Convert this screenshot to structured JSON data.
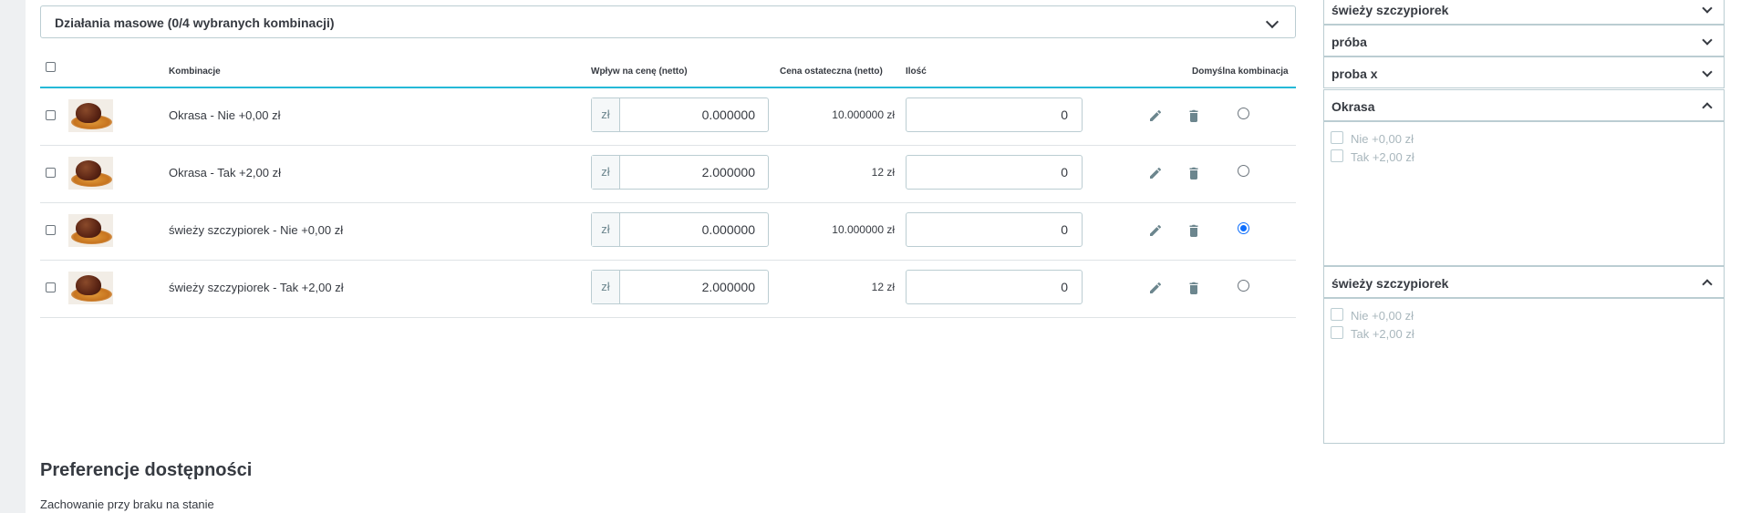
{
  "bulk_actions": {
    "label": "Działania masowe (0/4 wybranych kombinacji)"
  },
  "table": {
    "headers": {
      "combinations": "Kombinacje",
      "price_impact": "Wpływ na cenę (netto)",
      "final_price": "Cena ostateczna (netto)",
      "quantity": "Ilość",
      "default": "Domyślna kombinacja"
    },
    "rows": [
      {
        "name": "Okrasa - Nie +0,00 zł",
        "currency": "zł",
        "impact": "0.000000",
        "final": "10.000000 zł",
        "qty": "0",
        "default": false
      },
      {
        "name": "Okrasa - Tak +2,00 zł",
        "currency": "zł",
        "impact": "2.000000",
        "final": "12 zł",
        "qty": "0",
        "default": false
      },
      {
        "name": "świeży szczypiorek - Nie +0,00 zł",
        "currency": "zł",
        "impact": "0.000000",
        "final": "10.000000 zł",
        "qty": "0",
        "default": true
      },
      {
        "name": "świeży szczypiorek - Tak +2,00 zł",
        "currency": "zł",
        "impact": "2.000000",
        "final": "12 zł",
        "qty": "0",
        "default": false
      }
    ]
  },
  "availability": {
    "title": "Preferencje dostępności",
    "subtitle": "Zachowanie przy braku na stanie"
  },
  "sidebar": {
    "groups": [
      {
        "label": "świeży szczypiorek",
        "expanded": false
      },
      {
        "label": "próba",
        "expanded": false
      },
      {
        "label": "proba x",
        "expanded": false
      },
      {
        "label": "Okrasa",
        "expanded": true,
        "options": [
          "Nie +0,00 zł",
          "Tak +2,00 zł"
        ]
      },
      {
        "label": "świeży szczypiorek",
        "expanded": true,
        "options": [
          "Nie +0,00 zł",
          "Tak +2,00 zł"
        ]
      }
    ]
  },
  "colors": {
    "accent": "#25b9d7",
    "radio_selected": "#0d6efd",
    "border": "#bbcdd2"
  }
}
